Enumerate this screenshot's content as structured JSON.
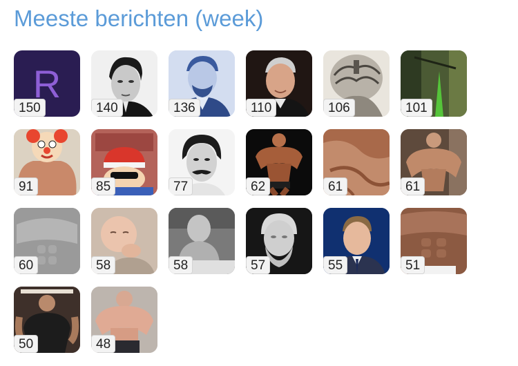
{
  "page": {
    "title": "Meeste berichten (week)"
  },
  "users": [
    {
      "count": "150",
      "letter": "R",
      "avatar": "letter-avatar"
    },
    {
      "count": "140",
      "avatar": "bw-portrait-avatar"
    },
    {
      "count": "136",
      "avatar": "blue-engraving-avatar"
    },
    {
      "count": "110",
      "avatar": "photo-portrait-avatar"
    },
    {
      "count": "106",
      "avatar": "engraving-brain-avatar"
    },
    {
      "count": "101",
      "avatar": "forest-avatar"
    },
    {
      "count": "91",
      "avatar": "clown-bodybuilder-avatar"
    },
    {
      "count": "85",
      "avatar": "cartoon-avatar"
    },
    {
      "count": "77",
      "avatar": "bw-mustache-avatar"
    },
    {
      "count": "62",
      "avatar": "bodybuilder-stage-avatar"
    },
    {
      "count": "61",
      "avatar": "muscle-closeup-avatar"
    },
    {
      "count": "61",
      "avatar": "bodybuilder-pose-avatar"
    },
    {
      "count": "60",
      "avatar": "muscle-render-avatar"
    },
    {
      "count": "58",
      "avatar": "baby-avatar"
    },
    {
      "count": "58",
      "avatar": "bw-man-table-avatar"
    },
    {
      "count": "57",
      "avatar": "bust-statue-avatar"
    },
    {
      "count": "55",
      "avatar": "news-anchor-avatar"
    },
    {
      "count": "51",
      "avatar": "abs-avatar"
    },
    {
      "count": "50",
      "avatar": "mirror-selfie-avatar"
    },
    {
      "count": "48",
      "avatar": "gym-bodybuilder-avatar"
    }
  ],
  "colors": {
    "title": "#5b9bd8",
    "letter_bg": "#2a1d52",
    "letter_fg": "#8e5fd6",
    "badge_bg": "#f3f3f3"
  }
}
